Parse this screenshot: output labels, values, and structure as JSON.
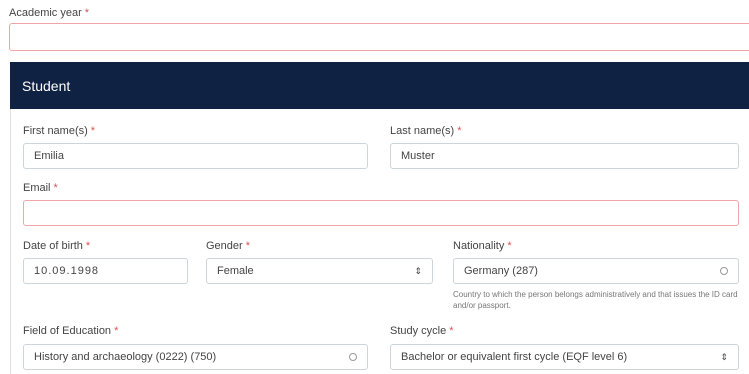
{
  "academic_year": {
    "label": "Academic year",
    "required": "*",
    "value": ""
  },
  "student": {
    "title": "Student",
    "first_name": {
      "label": "First name(s)",
      "required": "*",
      "value": "Emilia"
    },
    "last_name": {
      "label": "Last name(s)",
      "required": "*",
      "value": "Muster"
    },
    "email": {
      "label": "Email",
      "required": "*",
      "value": ""
    },
    "dob": {
      "label": "Date of birth",
      "required": "*",
      "value": "10.09.1998"
    },
    "gender": {
      "label": "Gender",
      "required": "*",
      "value": "Female"
    },
    "nationality": {
      "label": "Nationality",
      "required": "*",
      "value": "Germany (287)",
      "help": "Country to which the person belongs administratively and that issues the ID card and/or passport."
    },
    "field_of_education": {
      "label": "Field of Education",
      "required": "*",
      "value": "History and archaeology (0222) (750)"
    },
    "study_cycle": {
      "label": "Study cycle",
      "required": "*",
      "value": "Bachelor or equivalent first cycle (EQF level 6)"
    }
  },
  "colors": {
    "header_bg": "#0f2244",
    "error_border": "#f0a5a8",
    "required_star": "#d9534f"
  }
}
